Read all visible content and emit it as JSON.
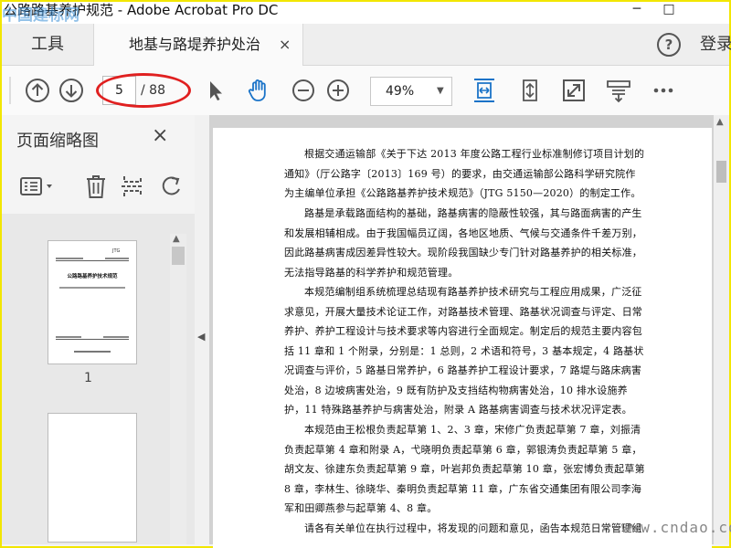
{
  "window": {
    "title": "公路路基养护规范 - Adobe Acrobat Pro DC",
    "minimize": "─",
    "maximize": "□",
    "watermark_top": "中国建标网"
  },
  "tabs": {
    "tools_label": "工具",
    "doc_label": "地基与路堤养护处治",
    "close": "×",
    "help": "?",
    "login": "登录"
  },
  "toolbar": {
    "current_page": "5",
    "total_pages": "/ 88",
    "zoom": "49%",
    "zoom_caret": "▼",
    "icons": [
      "prev-page-icon",
      "next-page-icon",
      "select-cursor-icon",
      "hand-tool-icon",
      "zoom-out-icon",
      "zoom-in-icon",
      "fit-width-icon",
      "fit-page-icon",
      "fullscreen-icon",
      "scroll-mode-icon",
      "more-icon"
    ]
  },
  "sidebar": {
    "title": "页面缩略图",
    "close": "×",
    "thumb1_header": "JTG",
    "thumb1_title": "公路路基养护技术规范",
    "thumb1_number": "1"
  },
  "document": {
    "paragraphs": [
      "根据交通运输部《关于下达 2013 年度公路工程行业标准制修订项目计划的通知》（厅公路字〔2013〕169 号）的要求，由交通运输部公路科学研究院作为主编单位承担《公路路基养护技术规范》（JTG 5150—2020）的制定工作。",
      "路基是承载路面结构的基础，路基病害的隐蔽性较强，其与路面病害的产生和发展相辅相成。由于我国幅员辽阔，各地区地质、气候与交通条件千差万别，因此路基病害成因差异性较大。现阶段我国缺少专门针对路基养护的相关标准，无法指导路基的科学养护和规范管理。",
      "本规范编制组系统梳理总结现有路基养护技术研究与工程应用成果，广泛征求意见，开展大量技术论证工作，对路基技术管理、路基状况调查与评定、日常养护、养护工程设计与技术要求等内容进行全面规定。制定后的规范主要内容包括 11 章和 1 个附录，分别是：1 总则，2 术语和符号，3 基本规定，4 路基状况调查与评价，5 路基日常养护，6 路基养护工程设计要求，7 路堤与路床病害处治，8 边坡病害处治，9 既有防护及支挡结构物病害处治，10 排水设施养护，11 特殊路基养护与病害处治，附录 A 路基病害调查与技术状况评定表。",
      "本规范由王松根负责起草第 1、2、3 章，宋修广负责起草第 7 章，刘振清负责起草第 4 章和附录 A，弋晓明负责起草第 6 章，郭银涛负责起草第 5 章，胡文友、徐建东负责起草第 9 章，叶岩邦负责起草第 10 章，张宏博负责起草第 8 章，李林生、徐晓华、秦明负责起草第 11 章，广东省交通集团有限公司李海军和田卿燕参与起草第 4、8 章。",
      "请各有关单位在执行过程中，将发现的问题和意见，函告本规范日常管理组"
    ]
  },
  "watermark_bottom": "www.cndao.com",
  "colors": {
    "annotation": "#e02020",
    "frame": "#f2e600",
    "accent": "#1a73c8"
  }
}
